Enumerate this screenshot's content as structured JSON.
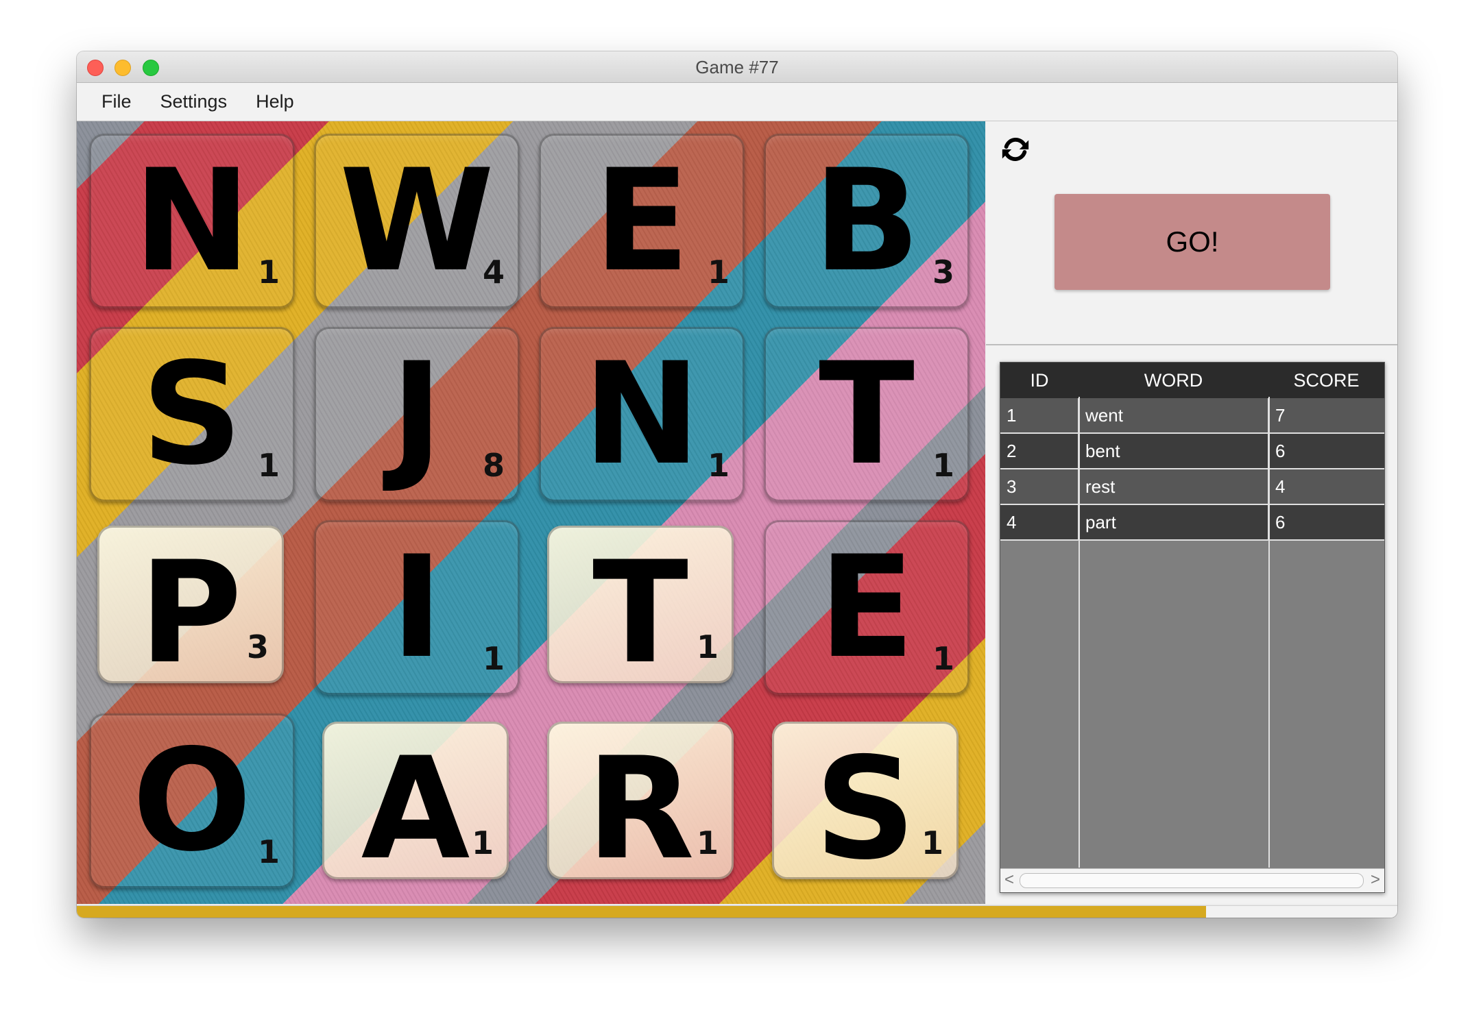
{
  "window": {
    "title": "Game #77"
  },
  "menu": {
    "file": "File",
    "settings": "Settings",
    "help": "Help"
  },
  "board": {
    "tiles": [
      {
        "letter": "N",
        "value": "1"
      },
      {
        "letter": "W",
        "value": "4"
      },
      {
        "letter": "E",
        "value": "1"
      },
      {
        "letter": "B",
        "value": "3"
      },
      {
        "letter": "S",
        "value": "1"
      },
      {
        "letter": "J",
        "value": "8"
      },
      {
        "letter": "N",
        "value": "1"
      },
      {
        "letter": "T",
        "value": "1"
      },
      {
        "letter": "P",
        "value": "3"
      },
      {
        "letter": "I",
        "value": "1"
      },
      {
        "letter": "T",
        "value": "1"
      },
      {
        "letter": "E",
        "value": "1"
      },
      {
        "letter": "O",
        "value": "1"
      },
      {
        "letter": "A",
        "value": "1"
      },
      {
        "letter": "R",
        "value": "1"
      },
      {
        "letter": "S",
        "value": "1"
      }
    ]
  },
  "controls": {
    "go_label": "GO!",
    "refresh_icon": "refresh-icon"
  },
  "words_table": {
    "headers": {
      "id": "ID",
      "word": "WORD",
      "score": "SCORE"
    },
    "rows": [
      {
        "id": "1",
        "word": "went",
        "score": "7"
      },
      {
        "id": "2",
        "word": "bent",
        "score": "6"
      },
      {
        "id": "3",
        "word": "rest",
        "score": "4"
      },
      {
        "id": "4",
        "word": "part",
        "score": "6"
      }
    ],
    "scroll_left": "<",
    "scroll_right": ">"
  },
  "timer": {
    "progress_fraction": 0.855,
    "fill_color": "#d6a920"
  }
}
